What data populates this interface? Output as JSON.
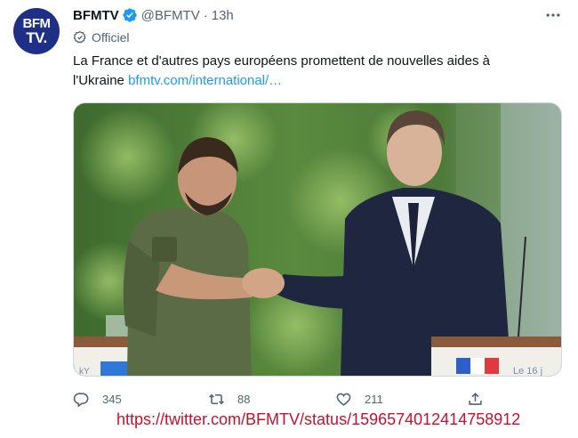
{
  "tweet": {
    "avatar_text_line1": "BFM",
    "avatar_text_line2": "TV.",
    "display_name": "BFMTV",
    "handle": "@BFMTV",
    "separator": "·",
    "time": "13h",
    "label": "Officiel",
    "text": "La France et d'autres pays européens promettent de nouvelles aides à l'Ukraine ",
    "link_text": "bfmtv.com/international/…"
  },
  "media": {
    "podium_left_text": "kY",
    "podium_right_text": "Le 16 j"
  },
  "actions": {
    "reply_count": "345",
    "retweet_count": "88",
    "like_count": "211"
  },
  "source_url": "https://twitter.com/BFMTV/status/1596574012414758912",
  "colors": {
    "avatar_bg": "#1d2f86",
    "verified": "#1d9bf0",
    "link": "#1d9bf0",
    "source_url": "#c8102e"
  },
  "icons": [
    "verified-badge-icon",
    "official-label-icon",
    "more-options-icon",
    "reply-icon",
    "retweet-icon",
    "like-icon",
    "share-icon"
  ]
}
